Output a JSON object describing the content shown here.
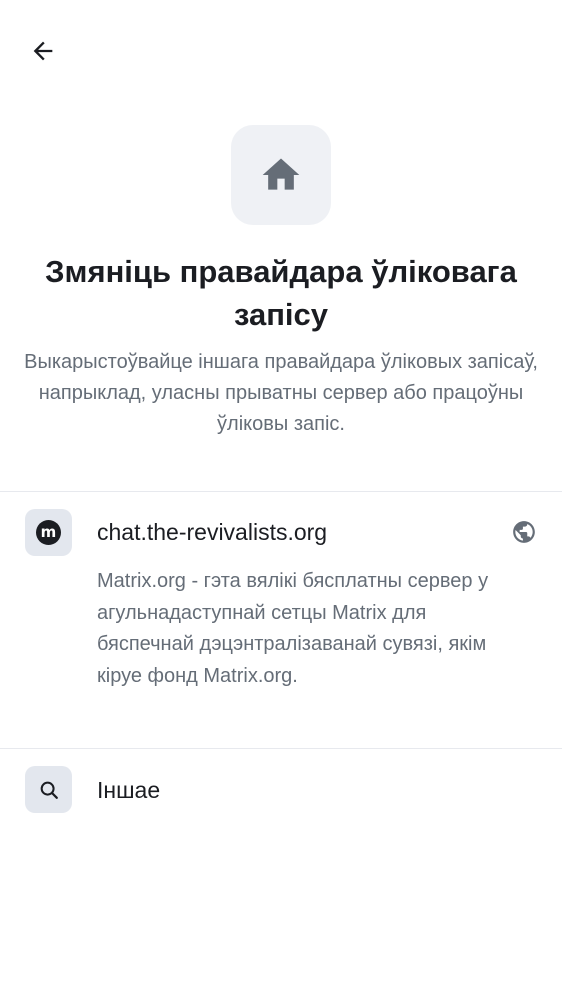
{
  "header": {
    "back_icon": "arrow-left-icon",
    "hero_icon": "home-icon",
    "title": "Змяніць правайдара ўліковага запісу",
    "subtitle": "Выкарыстоўвайце іншага правайдара ўліковых запісаў, напрыклад, уласны прыватны сервер або працоўны ўліковы запіс."
  },
  "providers": [
    {
      "icon": "matrix-logo-icon",
      "logo_letter": "m",
      "name": "chat.the-revivalists.org",
      "trailing_icon": "globe-icon",
      "description": "Matrix.org - гэта вялікі бясплатны сервер у агульнадаступнай сетцы Matrix для бяспечнай дэцэнтралізаванай сувязі, якім кіруе фонд Matrix.org."
    }
  ],
  "other": {
    "icon": "search-icon",
    "label": "Іншае"
  },
  "colors": {
    "background": "#ffffff",
    "icon_tile": "#eff1f5",
    "text_primary": "#1b1d22",
    "text_secondary": "#656d77",
    "divider": "#e7e9ee"
  }
}
